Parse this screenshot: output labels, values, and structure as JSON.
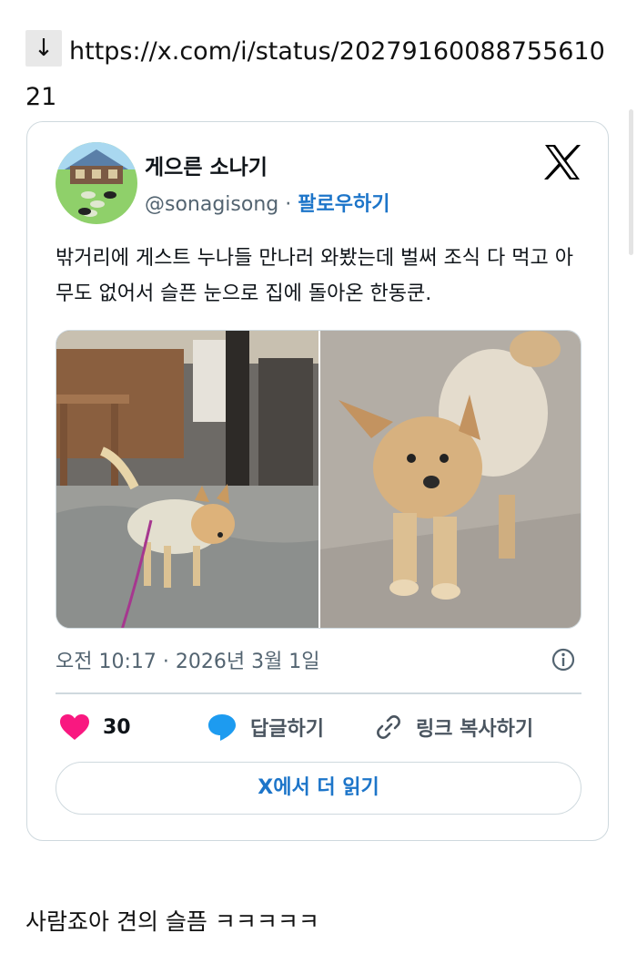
{
  "link": {
    "arrow_icon": "down-arrow-icon",
    "arrow_glyph": "↓",
    "url": "https://x.com/i/status/2027916008875561021"
  },
  "tweet": {
    "display_name": "게으른 소나기",
    "handle": "@sonagisong",
    "separator": "·",
    "follow_label": "팔로우하기",
    "text": "밖거리에 게스트 누나들 만나러 와봤는데 벌써 조식 다 먹고 아무도 없어서 슬픈 눈으로 집에 돌아온 한동쿤.",
    "timestamp": "오전 10:17 · 2026년 3월 1일",
    "likes": "30",
    "reply_label": "답글하기",
    "copy_link_label": "링크 복사하기",
    "read_more_label": "X에서 더 읽기",
    "brand_color": "#1d75c9",
    "heart_color": "#f91880"
  },
  "post": {
    "comment": "사람죠아 견의 슬픔 ㅋㅋㅋㅋㅋ"
  }
}
